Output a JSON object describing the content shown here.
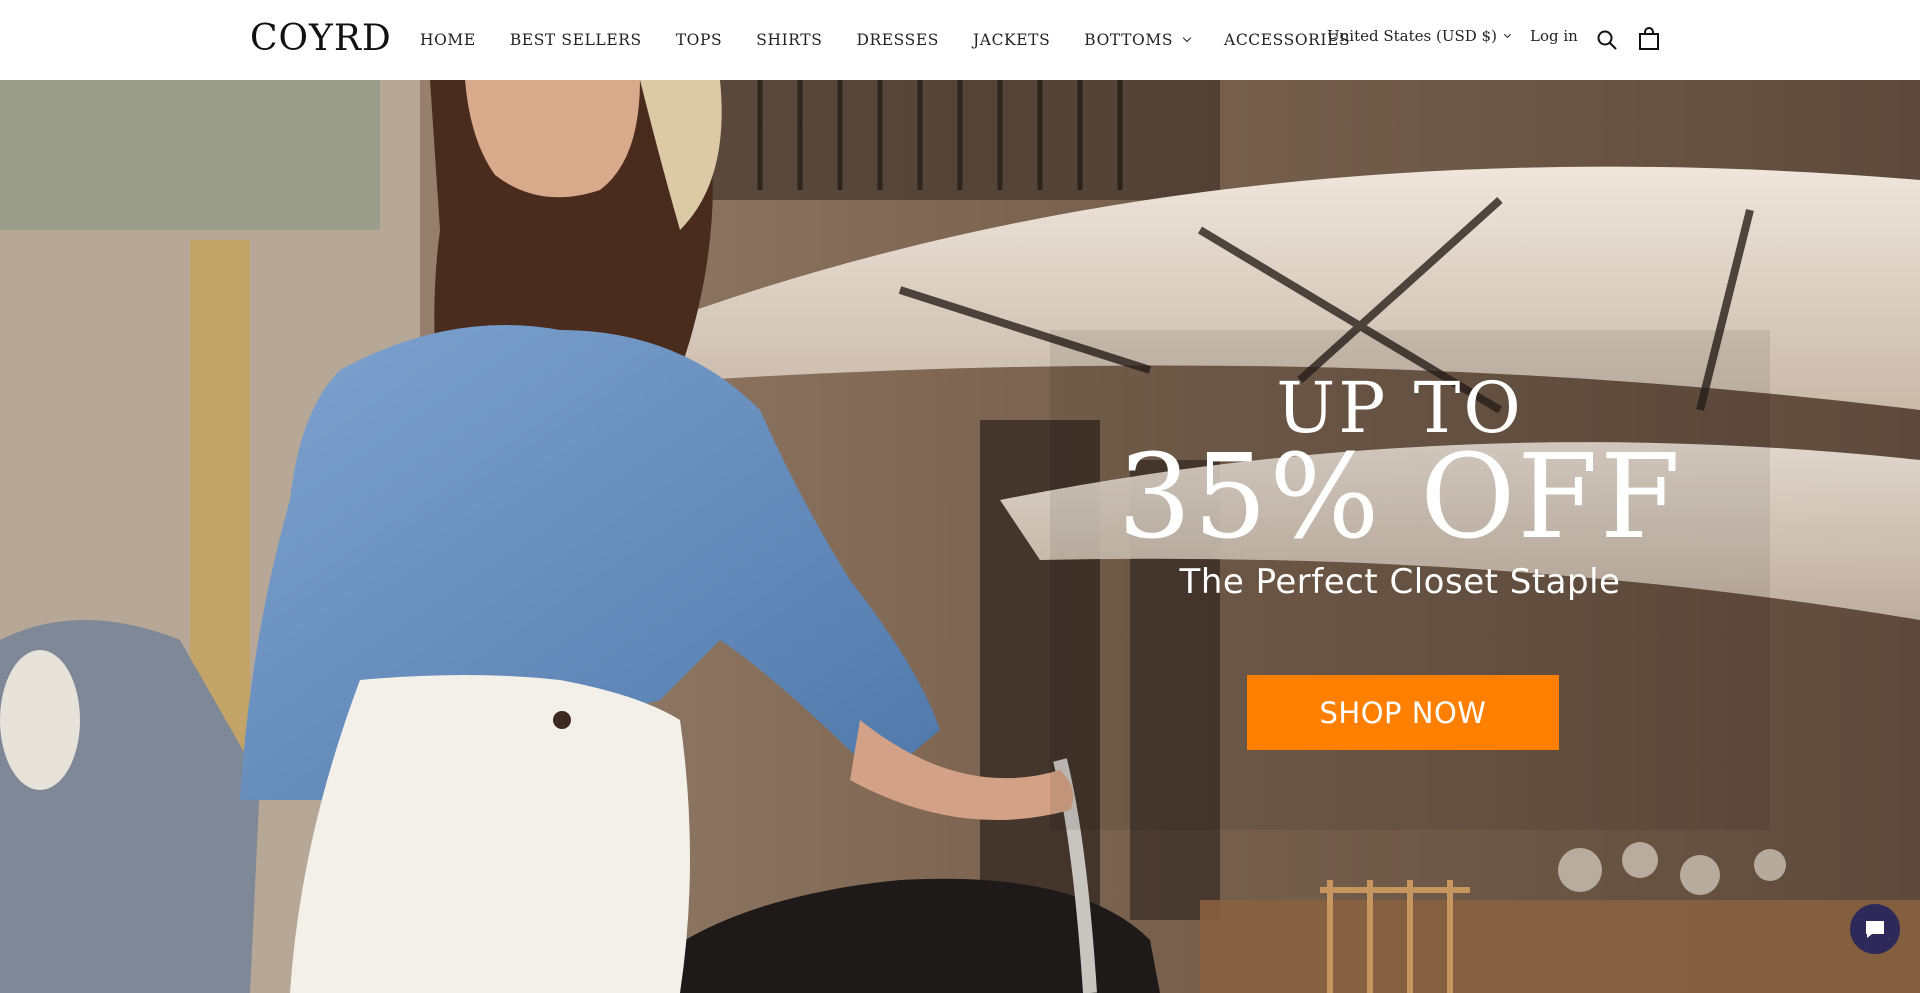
{
  "header": {
    "logo": "COYRD",
    "nav": [
      {
        "label": "HOME"
      },
      {
        "label": "BEST SELLERS"
      },
      {
        "label": "TOPS"
      },
      {
        "label": "SHIRTS"
      },
      {
        "label": "DRESSES"
      },
      {
        "label": "JACKETS"
      },
      {
        "label": "BOTTOMS",
        "has_dropdown": true
      },
      {
        "label": "ACCESSORIES"
      }
    ],
    "currency": "United States (USD $)",
    "login": "Log in",
    "icons": [
      "search-icon",
      "cart-icon",
      "chevron-down-icon"
    ]
  },
  "hero": {
    "line1": "UP TO",
    "line2": "35% OFF",
    "subtitle": "The Perfect Closet Staple",
    "cta": "SHOP NOW",
    "cta_color": "#ff7f00",
    "text_color": "#ffffff"
  },
  "chat": {
    "icon": "chat-bubble-icon",
    "color": "#2d2a5a"
  }
}
